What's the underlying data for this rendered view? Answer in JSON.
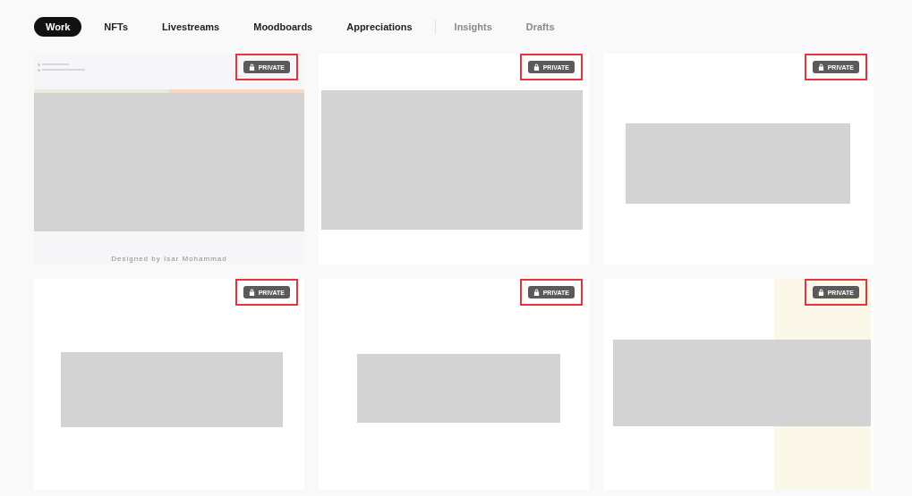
{
  "tabs": [
    {
      "label": "Work",
      "selected": true,
      "muted": false
    },
    {
      "label": "NFTs",
      "selected": false,
      "muted": false
    },
    {
      "label": "Livestreams",
      "selected": false,
      "muted": false
    },
    {
      "label": "Moodboards",
      "selected": false,
      "muted": false
    },
    {
      "label": "Appreciations",
      "selected": false,
      "muted": false
    },
    {
      "label": "Insights",
      "selected": false,
      "muted": true
    },
    {
      "label": "Drafts",
      "selected": false,
      "muted": true
    }
  ],
  "projects": [
    {
      "kind": "poster",
      "badge": "PRIVATE",
      "highlighted": true,
      "footer": "Designed by Isar Mohammad"
    },
    {
      "kind": "wide",
      "badge": "PRIVATE",
      "highlighted": true
    },
    {
      "kind": "centered",
      "badge": "PRIVATE",
      "highlighted": true
    },
    {
      "kind": "low",
      "badge": "PRIVATE",
      "highlighted": true
    },
    {
      "kind": "small",
      "badge": "PRIVATE",
      "highlighted": true
    },
    {
      "kind": "stripe",
      "badge": "PRIVATE",
      "highlighted": true
    }
  ]
}
